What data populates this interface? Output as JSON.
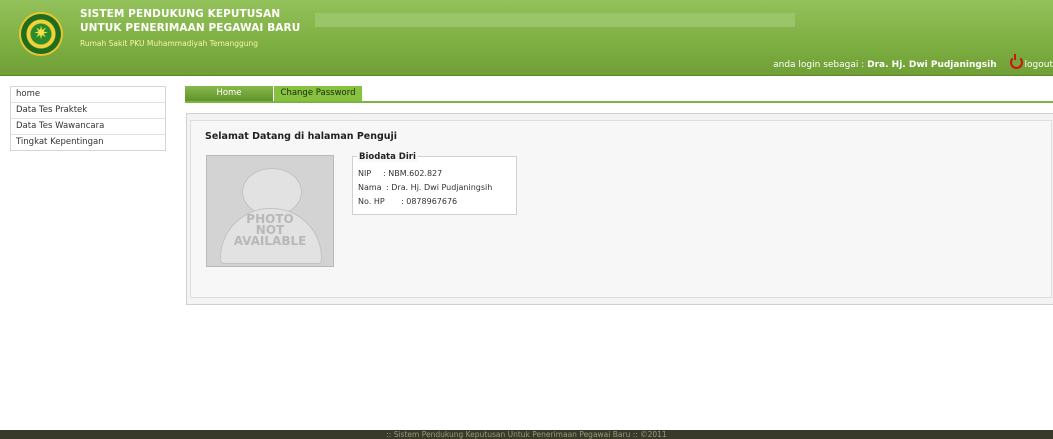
{
  "header": {
    "title_line1": "SISTEM PENDUKUNG KEPUTUSAN",
    "title_line2": "UNTUK PENERIMAAN PEGAWAI BARU",
    "subtitle": "Rumah Sakit PKU Muhammadiyah Temanggung",
    "login_prefix": "anda login sebagai : ",
    "user_name": "Dra. Hj. Dwi Pudjaningsih",
    "logout_label": "logout",
    "logo_icon": "muhammadiyah-logo",
    "colors": {
      "header_green": "#7fb043",
      "accent": "#86c23f",
      "logout_red": "#d21010"
    }
  },
  "sidebar": {
    "items": [
      {
        "label": "home"
      },
      {
        "label": "Data Tes Praktek"
      },
      {
        "label": "Data Tes Wawancara"
      },
      {
        "label": "Tingkat Kepentingan"
      }
    ]
  },
  "tabs": [
    {
      "label": "Home"
    },
    {
      "label": "Change Password"
    }
  ],
  "main": {
    "welcome": "Selamat Datang di halaman Penguji",
    "photo_text": "PHOTO\nNOT\nAVAILABLE",
    "biodata": {
      "legend": "Biodata Diri",
      "nip_label": "NIP",
      "nip_value": ": NBM.602.827",
      "nama_label": "Nama",
      "nama_value": ": Dra. Hj. Dwi Pudjaningsih",
      "hp_label": "No. HP",
      "hp_value": ": 0878967676"
    }
  },
  "footer": {
    "text": ":: Sistem Pendukung Keputusan Untuk Penerimaan Pegawai Baru :: ©2011"
  }
}
